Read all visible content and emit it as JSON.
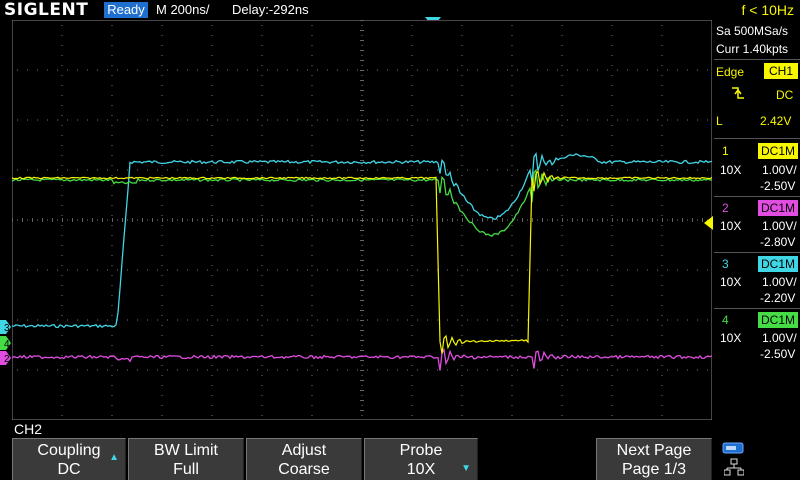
{
  "header": {
    "brand": "SIGLENT",
    "status": "Ready",
    "timebase": "M 200ns/",
    "delay": "Delay:-292ns",
    "frequency": "f < 10Hz"
  },
  "acquisition": {
    "sample_rate": "Sa 500MSa/s",
    "memory": "Curr 1.40kpts"
  },
  "trigger": {
    "type": "Edge",
    "source": "CH1",
    "coupling": "DC",
    "slope_label": "L",
    "level": "2.42V",
    "slope_icon": "rising-edge-icon"
  },
  "channels": [
    {
      "num": "1",
      "coupling": "DC1M",
      "probe": "10X",
      "scale": "1.00V/",
      "offset": "-2.50V",
      "color": "#f7f700"
    },
    {
      "num": "2",
      "coupling": "DC1M",
      "probe": "10X",
      "scale": "1.00V/",
      "offset": "-2.80V",
      "color": "#e14de1"
    },
    {
      "num": "3",
      "coupling": "DC1M",
      "probe": "10X",
      "scale": "1.00V/",
      "offset": "-2.20V",
      "color": "#3fd6e6"
    },
    {
      "num": "4",
      "coupling": "DC1M",
      "probe": "10X",
      "scale": "1.00V/",
      "offset": "-2.50V",
      "color": "#45dc45"
    }
  ],
  "markers": {
    "ch3": "3",
    "ch4": "4",
    "ch2": "2"
  },
  "active_channel": "CH2",
  "softkeys": [
    {
      "title": "Coupling",
      "value": "DC"
    },
    {
      "title": "BW Limit",
      "value": "Full"
    },
    {
      "title": "Adjust",
      "value": "Coarse"
    },
    {
      "title": "Probe",
      "value": "10X"
    },
    {
      "title": "Next Page",
      "value": "Page 1/3"
    }
  ],
  "icons": {
    "usb": "usb-icon",
    "network": "network-icon",
    "trigger_pos": "trigger-position-marker-icon",
    "trigger_level": "trigger-level-arrow-icon"
  }
}
